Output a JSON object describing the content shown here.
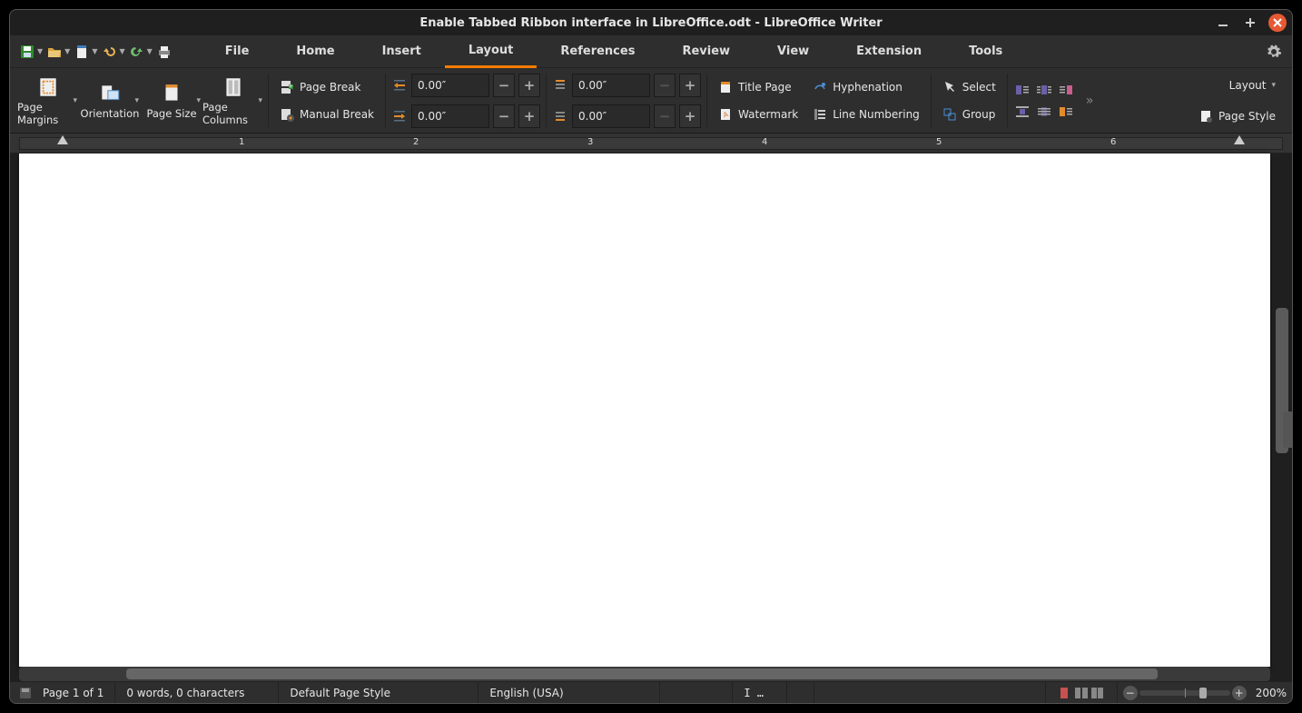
{
  "title": "Enable Tabbed Ribbon interface in LibreOffice.odt - LibreOffice Writer",
  "tabs": [
    "File",
    "Home",
    "Insert",
    "Layout",
    "References",
    "Review",
    "View",
    "Extension",
    "Tools"
  ],
  "active_tab": "Layout",
  "ribbon": {
    "big": {
      "page_margins": "Page Margins",
      "orientation": "Orientation",
      "page_size": "Page Size",
      "page_columns": "Page Columns"
    },
    "breaks": {
      "page_break": "Page Break",
      "manual_break": "Manual Break"
    },
    "indent": {
      "left": "0.00″",
      "right": "0.00″"
    },
    "spacing": {
      "above": "0.00″",
      "below": "0.00″"
    },
    "pagetools": {
      "title_page": "Title Page",
      "watermark": "Watermark",
      "hyphenation": "Hyphenation",
      "line_numbering": "Line Numbering"
    },
    "arrange": {
      "select": "Select",
      "group": "Group"
    },
    "right": {
      "layout": "Layout",
      "page_style": "Page Style"
    }
  },
  "ruler_nums": [
    "1",
    "2",
    "3",
    "4",
    "5",
    "6"
  ],
  "status": {
    "page": "Page 1 of 1",
    "words": "0 words, 0 characters",
    "style": "Default Page Style",
    "lang": "English (USA)",
    "zoom": "200%"
  }
}
